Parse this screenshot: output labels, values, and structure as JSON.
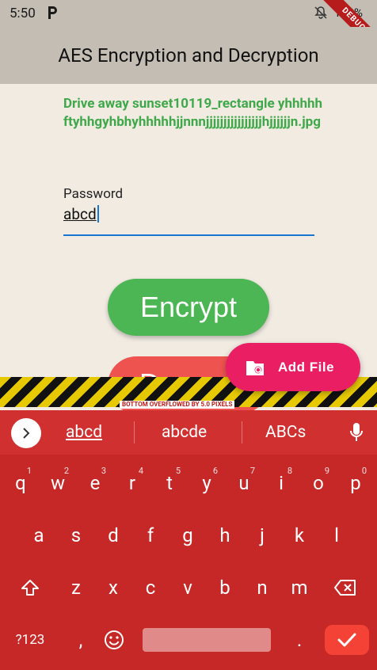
{
  "status": {
    "time": "5:50",
    "battery": "100%",
    "debug": "DEBUG"
  },
  "app_bar": {
    "title": "AES Encryption and Decryption"
  },
  "file": {
    "name": "Drive away sunset10119_rectangle yhhhhhftyhhgyhbhyhhhhhjjnnnjjjjjjjjjjjjjjjjhjjjjjjn.jpg"
  },
  "password": {
    "label": "Password",
    "value": "abcd"
  },
  "buttons": {
    "encrypt": "Encrypt",
    "decrypt": "Decrypt",
    "add_file": "Add File"
  },
  "overflow_warning": "BOTTOM OVERFLOWED BY 5.0 PIXELS",
  "keyboard": {
    "suggestions": [
      "abcd",
      "abcde",
      "ABCs"
    ],
    "row1": [
      "q",
      "w",
      "e",
      "r",
      "t",
      "y",
      "u",
      "i",
      "o",
      "p"
    ],
    "row1_hints": [
      "1",
      "2",
      "3",
      "4",
      "5",
      "6",
      "7",
      "8",
      "9",
      "0"
    ],
    "row2": [
      "a",
      "s",
      "d",
      "f",
      "g",
      "h",
      "j",
      "k",
      "l"
    ],
    "row3": [
      "z",
      "x",
      "c",
      "v",
      "b",
      "n",
      "m"
    ],
    "symbols": "?123",
    "comma": ",",
    "period": "."
  },
  "colors": {
    "encrypt": "#4bb653",
    "decrypt": "#ef5350",
    "fab": "#e91e63",
    "keyboard": "#c62828",
    "filename": "#3fa84a"
  }
}
